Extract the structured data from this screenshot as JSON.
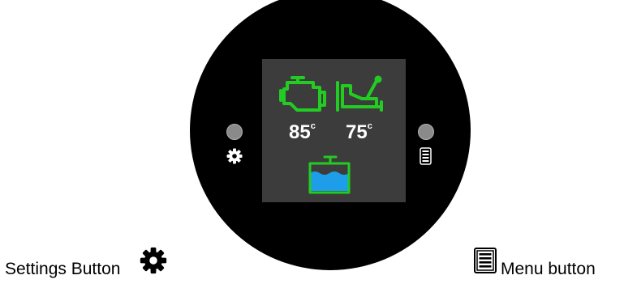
{
  "display": {
    "engine_temp": "85",
    "engine_temp_unit": "c",
    "transmission_temp": "75",
    "transmission_temp_unit": "c"
  },
  "icons": {
    "engine": "engine-icon",
    "transmission": "transmission-icon",
    "coolant": "coolant-tank-icon",
    "settings": "gear-icon",
    "menu": "menu-icon"
  },
  "captions": {
    "settings_button": "Settings Button",
    "menu_button": "Menu button"
  },
  "colors": {
    "device_body": "#000000",
    "screen_bg": "#3c3c3c",
    "icon_green": "#22cc22",
    "coolant_blue": "#1e9ee8",
    "text_white": "#ffffff",
    "button_grey": "#8a8a8a"
  }
}
